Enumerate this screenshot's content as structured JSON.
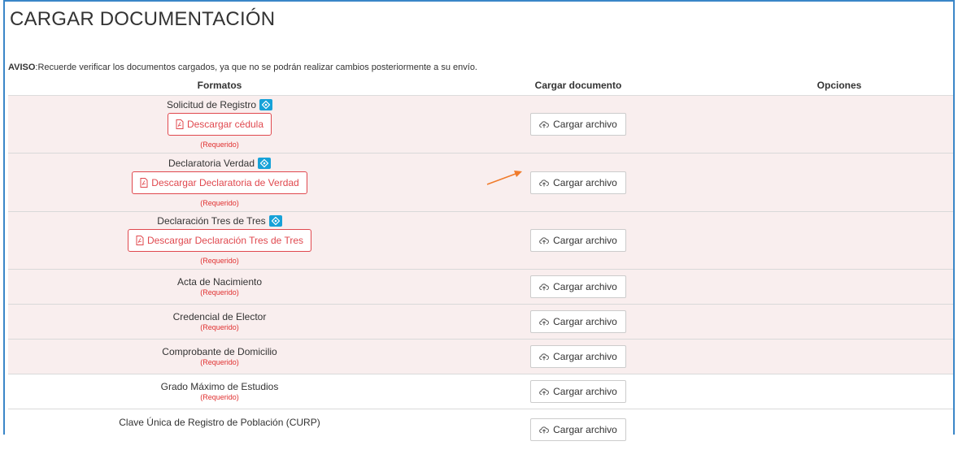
{
  "page": {
    "title": "CARGAR DOCUMENTACIÓN",
    "notice_label": "AVISO",
    "notice_text": ":Recuerde verificar los documentos cargados, ya que no se podrán realizar cambios posteriormente a su envío."
  },
  "table": {
    "headers": [
      "Formatos",
      "Cargar documento",
      "Opciones"
    ],
    "upload_label": "Cargar archivo",
    "required_label": "(Requerido)",
    "rows": [
      {
        "name": "Solicitud de Registro",
        "download": "Descargar cédula"
      },
      {
        "name": "Declaratoria Verdad",
        "download": "Descargar Declaratoria de Verdad"
      },
      {
        "name": "Declaración Tres de Tres",
        "download": "Descargar Declaración Tres de Tres"
      },
      {
        "name": "Acta de Nacimiento"
      },
      {
        "name": "Credencial de Elector"
      },
      {
        "name": "Comprobante de Domicilio"
      },
      {
        "name": "Grado Máximo de Estudios"
      },
      {
        "name": "Clave Única de Registro de Población (CURP)"
      }
    ]
  },
  "colors": {
    "accent": "#3a86c8",
    "danger": "#e0484e",
    "info": "#17a2d8",
    "arrow": "#f07b2b",
    "row_shade": "#f9eeee"
  },
  "icons": [
    "info-icon",
    "pdf-icon",
    "cloud-upload-icon",
    "annotation-arrow"
  ]
}
